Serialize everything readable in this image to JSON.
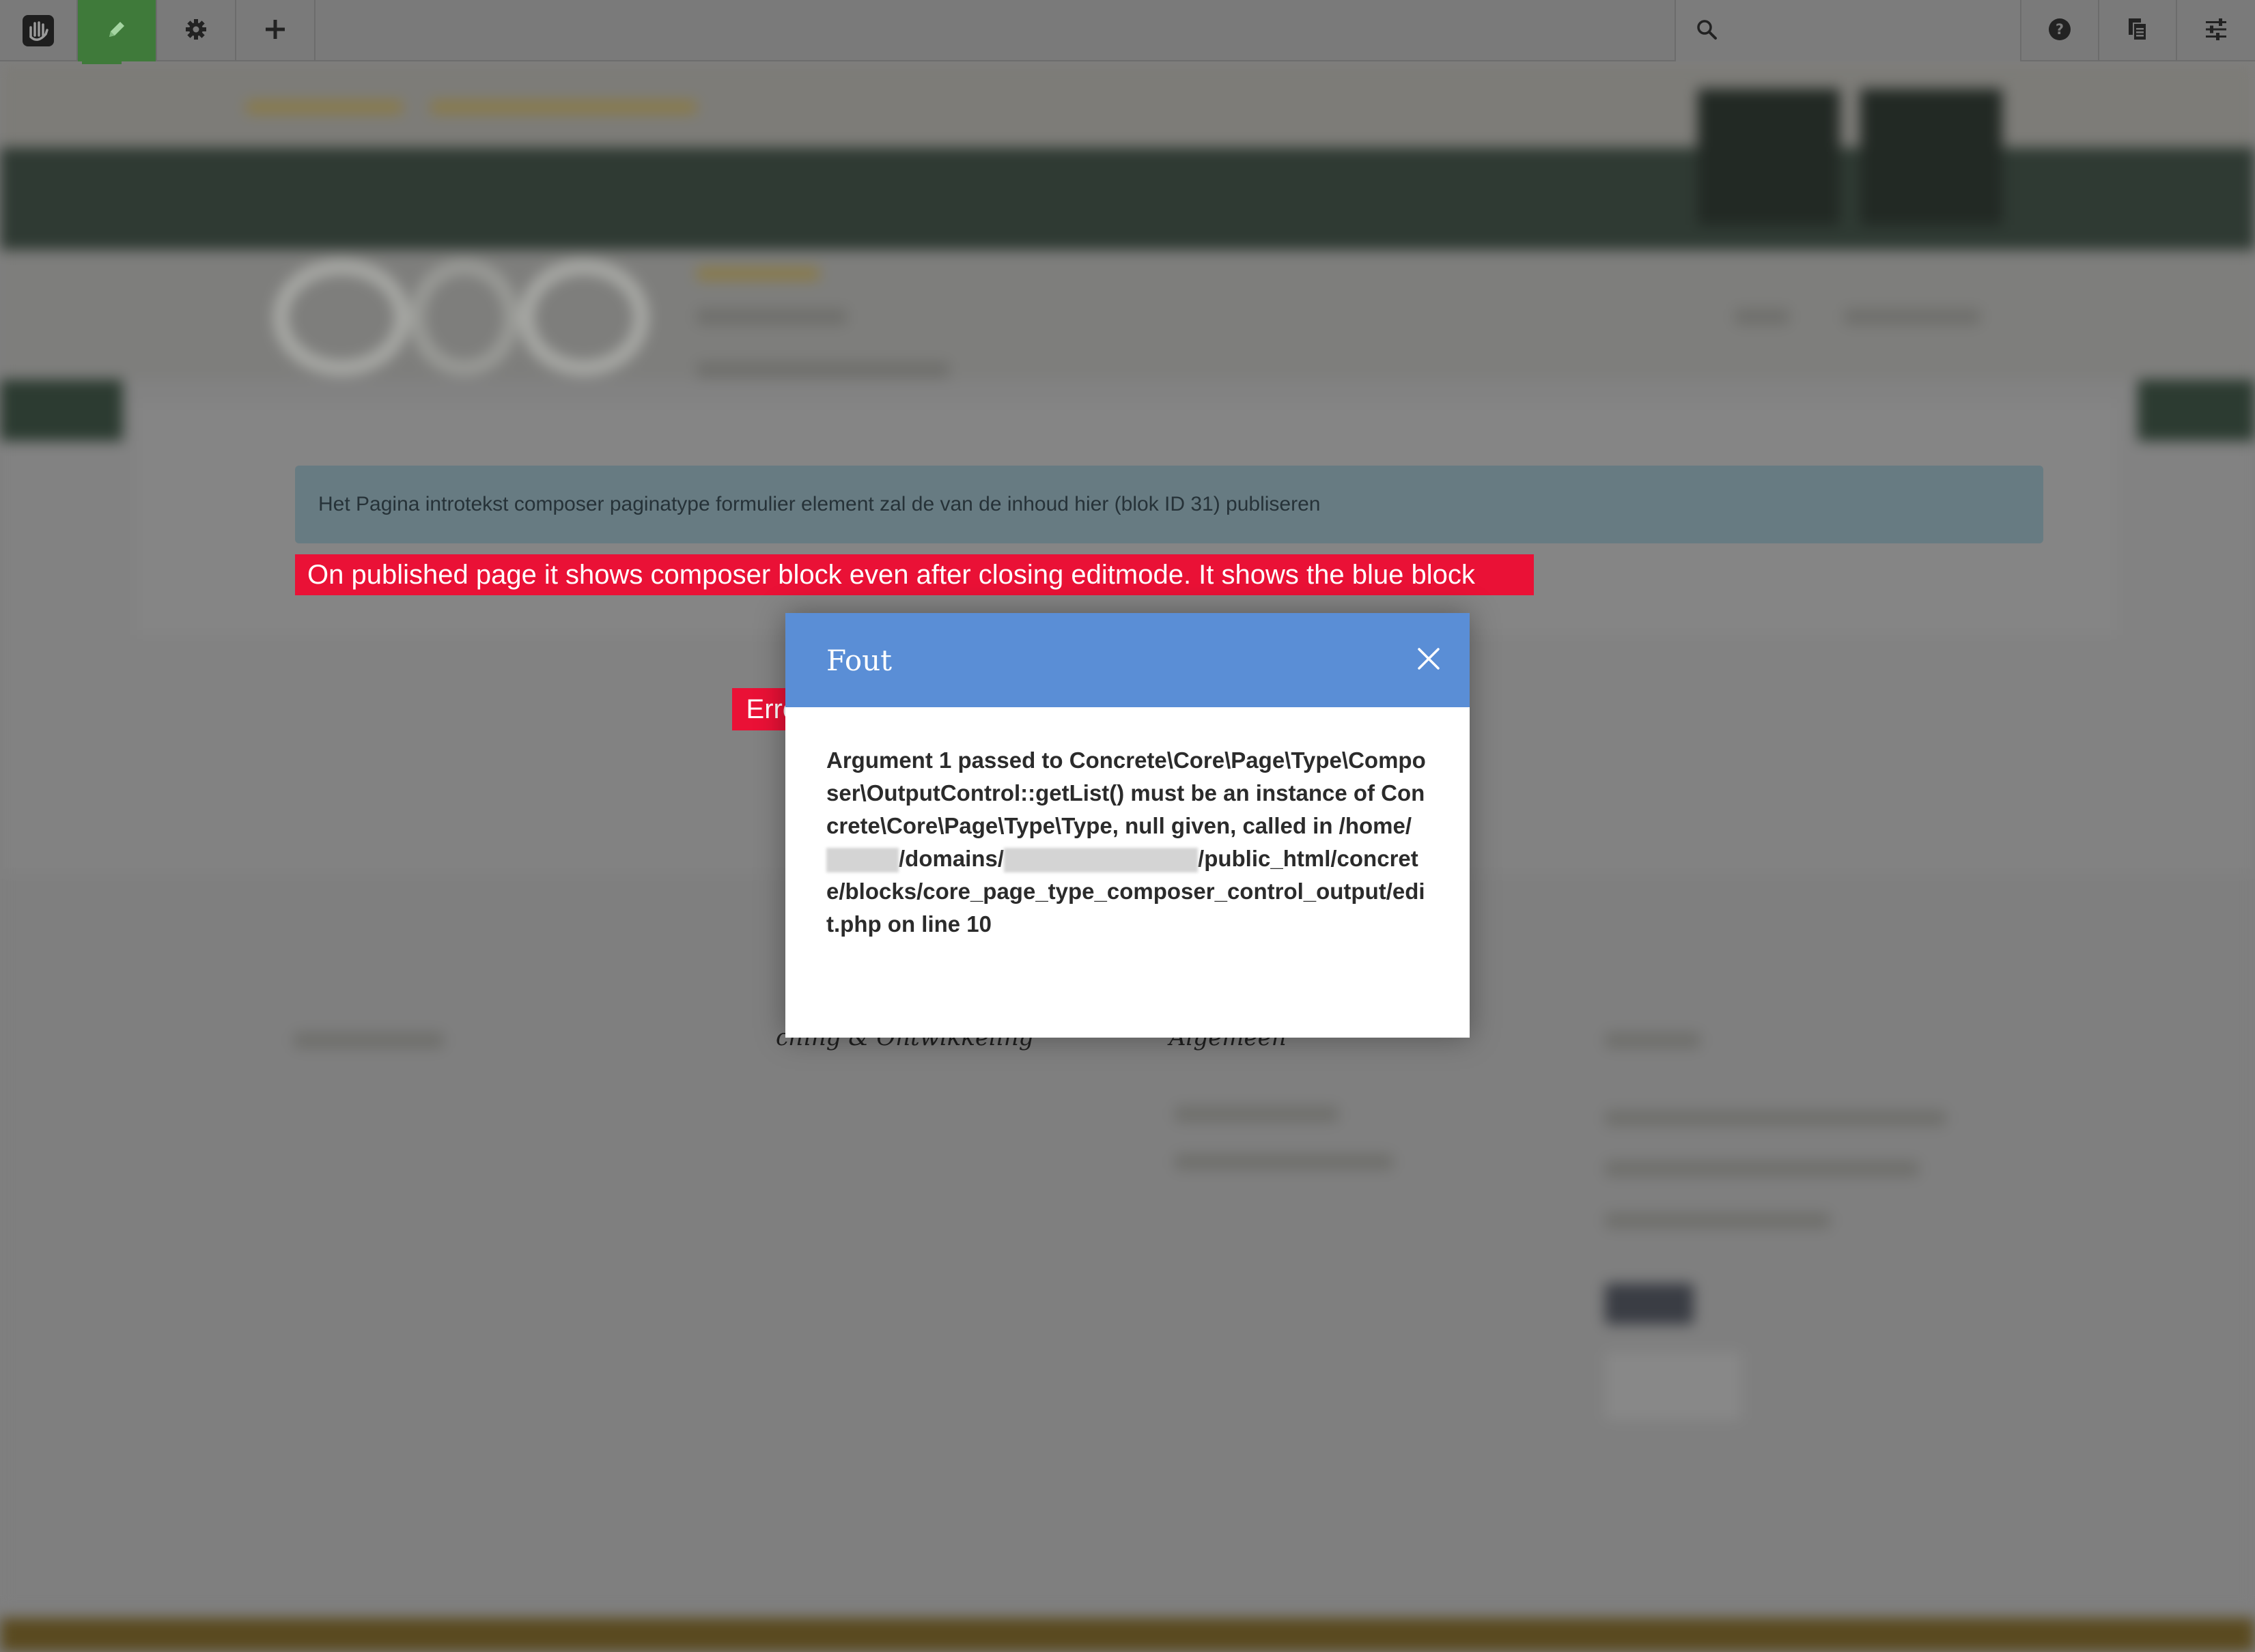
{
  "toolbar": {
    "buttons": [
      {
        "icon": "concrete-hand-logo-icon"
      },
      {
        "icon": "pencil-icon",
        "active": true
      },
      {
        "icon": "gear-icon"
      },
      {
        "icon": "plus-icon"
      }
    ],
    "right_buttons": [
      {
        "icon": "help-circle-icon"
      },
      {
        "icon": "pages-icon"
      },
      {
        "icon": "sliders-icon"
      }
    ],
    "search_icon": "search-icon",
    "colors": {
      "bar": "#7a7a7a",
      "edit_active": "#3f7a3a"
    }
  },
  "page": {
    "info_alert": "Het Pagina introtekst composer paginatype formulier element zal de van de inhoud hier (blok ID 31) publiseren",
    "footer_visible_headings": [
      "ching & Ontwikkeling",
      "Algemeen"
    ]
  },
  "annotations": {
    "main_note": "On published page it shows composer block even after closing editmode. It shows the blue block",
    "error_label": "Error",
    "color": "#ea1136"
  },
  "modal": {
    "title": "Fout",
    "close_icon": "close-icon",
    "header_color": "#5a8ed6",
    "message_part1": "Argument 1 passed to Concrete\\Core\\Page\\Type\\Composer\\OutputControl::getList() must be an instance of Concrete\\Core\\Page\\Type\\Type, null given, called in /home/",
    "message_part2": "/domains/",
    "message_part3": "/public_html/concrete/blocks/core_page_type_composer_control_output/edit.php on line 10"
  }
}
